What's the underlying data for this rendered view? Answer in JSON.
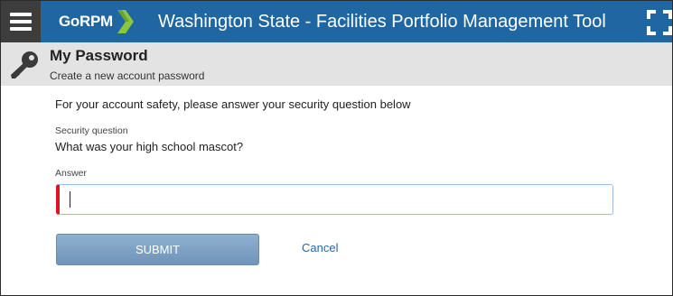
{
  "header": {
    "brand": "GoRPM",
    "title": "Washington State - Facilities Portfolio Management Tool",
    "colors": {
      "bar": "#1f67a3",
      "menu": "#3d3d3d",
      "logo_green": "#8cc63f"
    }
  },
  "subheader": {
    "title": "My Password",
    "subtitle": "Create a new account password"
  },
  "form": {
    "intro": "For your account safety, please answer your security question below",
    "security_question_label": "Security question",
    "security_question": "What was your high school mascot?",
    "answer_label": "Answer",
    "answer_value": "",
    "submit_label": "SUBMIT",
    "cancel_label": "Cancel"
  }
}
